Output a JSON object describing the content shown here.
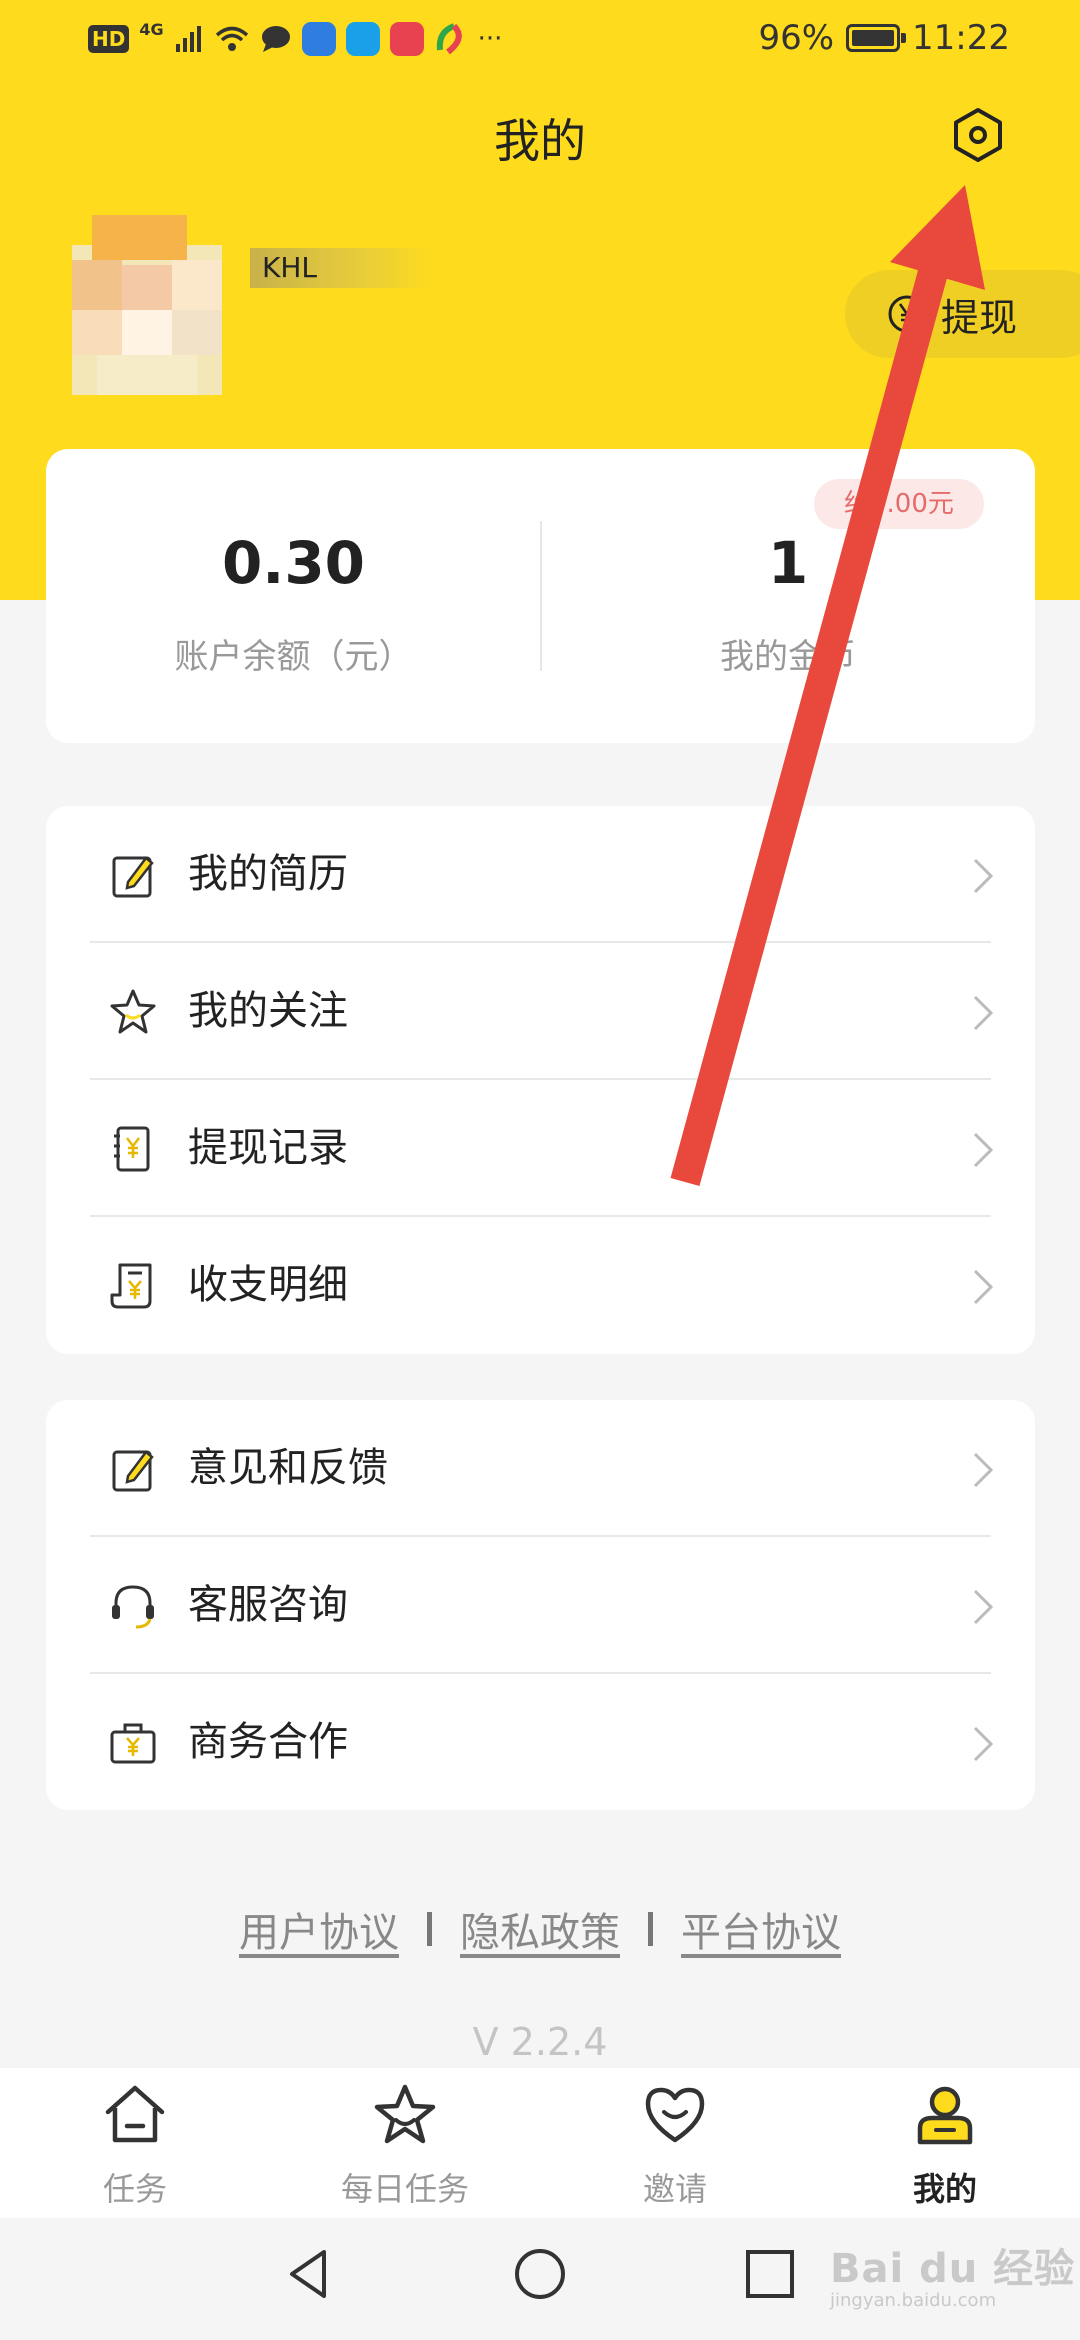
{
  "status_bar": {
    "hd": "HD",
    "network": "4G",
    "battery": "96%",
    "time": "11:22"
  },
  "header": {
    "title": "我的",
    "settings_icon": "settings-gear-icon"
  },
  "profile": {
    "username": "KHL",
    "withdraw_label": "提现",
    "withdraw_icon": "yen-circle-icon"
  },
  "account": {
    "balance_value": "0.30",
    "balance_label": "账户余额（元）",
    "coins_value": "1",
    "coins_label": "我的金币",
    "coins_badge": "约0.00元"
  },
  "menu_group_1": [
    {
      "label": "我的简历",
      "icon": "edit-resume-icon"
    },
    {
      "label": "我的关注",
      "icon": "star-icon"
    },
    {
      "label": "提现记录",
      "icon": "withdraw-record-icon"
    },
    {
      "label": "收支明细",
      "icon": "bill-detail-icon"
    }
  ],
  "menu_group_2": [
    {
      "label": "意见和反馈",
      "icon": "feedback-icon"
    },
    {
      "label": "客服咨询",
      "icon": "headset-icon"
    },
    {
      "label": "商务合作",
      "icon": "briefcase-icon"
    }
  ],
  "footer": {
    "user_agreement": "用户协议",
    "privacy_policy": "隐私政策",
    "platform_agreement": "平台协议",
    "version": "V 2.2.4"
  },
  "bottom_nav": [
    {
      "label": "任务",
      "icon": "home-icon"
    },
    {
      "label": "每日任务",
      "icon": "star-icon"
    },
    {
      "label": "邀请",
      "icon": "heart-smile-icon"
    },
    {
      "label": "我的",
      "icon": "person-icon",
      "active": true
    }
  ],
  "watermark": {
    "text": "Bai du 经验",
    "sub": "jingyan.baidu.com"
  },
  "colors": {
    "brand_yellow": "#fedb1c",
    "annotation_red": "#e8493c"
  }
}
